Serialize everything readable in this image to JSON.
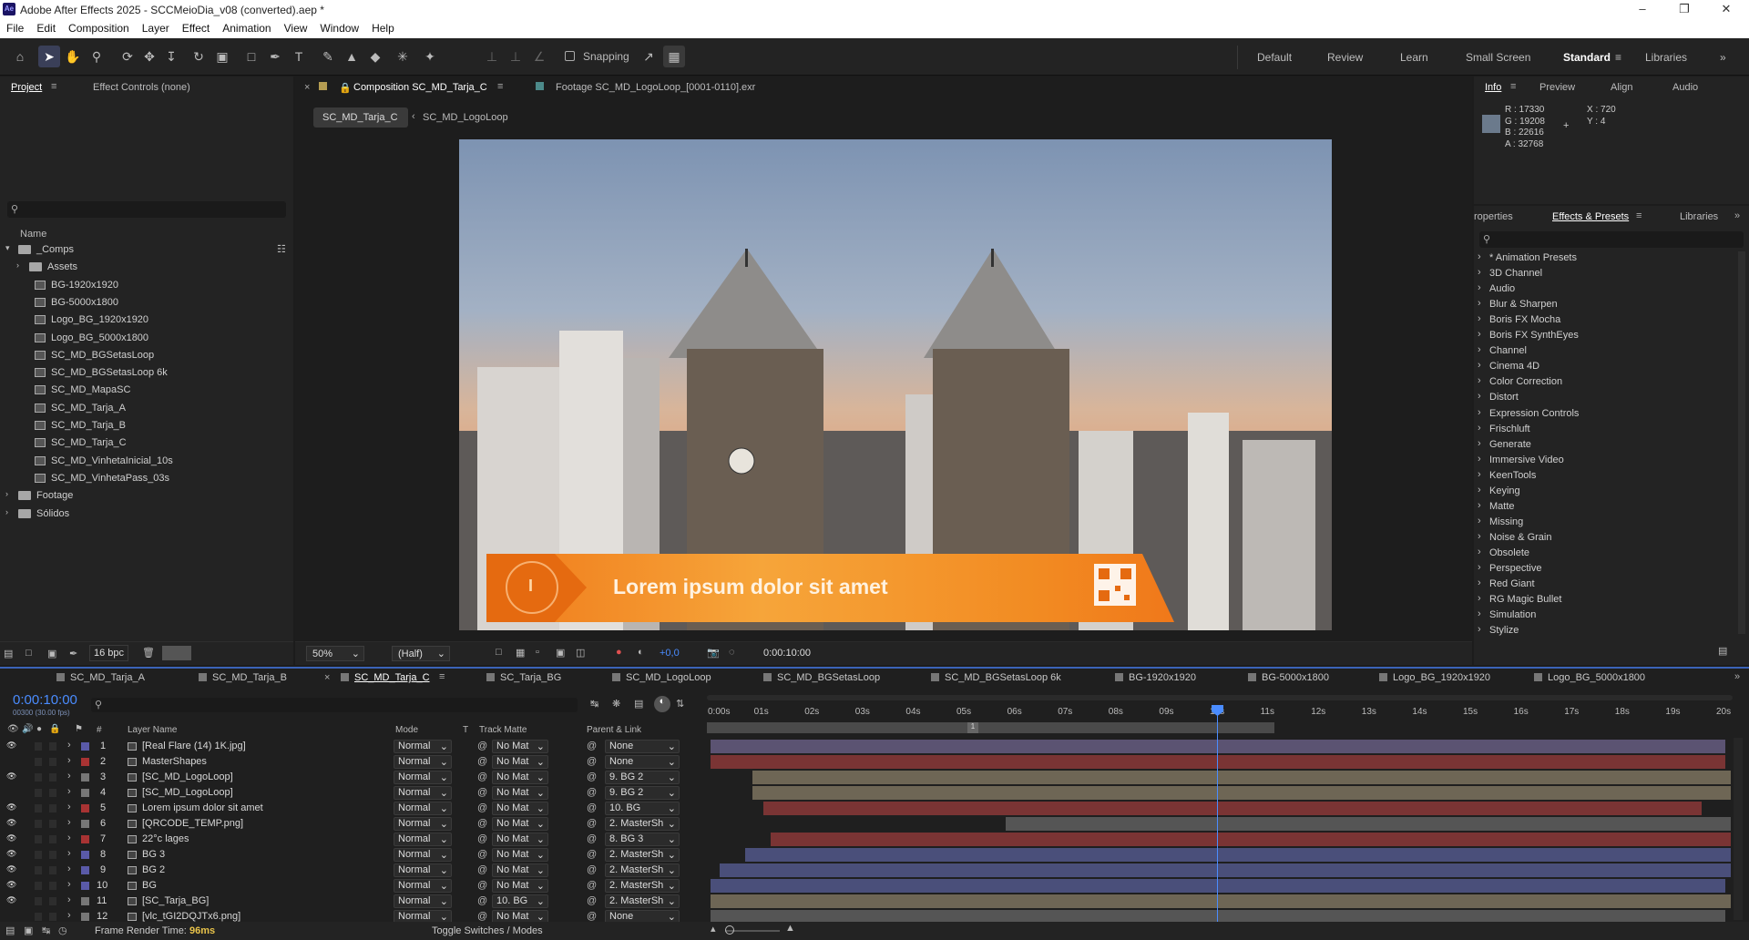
{
  "app": {
    "title": "Adobe After Effects 2025 - SCCMeioDia_v08 (converted).aep *",
    "logo": "Ae"
  },
  "menu": [
    "File",
    "Edit",
    "Composition",
    "Layer",
    "Effect",
    "Animation",
    "View",
    "Window",
    "Help"
  ],
  "toolbar": {
    "snapping_label": "Snapping"
  },
  "workspaces": [
    "Default",
    "Review",
    "Learn",
    "Small Screen",
    "Standard",
    "Libraries"
  ],
  "project": {
    "tabs": {
      "project": "Project",
      "effect_controls": "Effect Controls (none)"
    },
    "name_header": "Name",
    "items": [
      {
        "label": "_Comps",
        "type": "folder-open"
      },
      {
        "label": "Assets",
        "type": "folder"
      },
      {
        "label": "BG-1920x1920",
        "type": "comp"
      },
      {
        "label": "BG-5000x1800",
        "type": "comp"
      },
      {
        "label": "Logo_BG_1920x1920",
        "type": "comp"
      },
      {
        "label": "Logo_BG_5000x1800",
        "type": "comp"
      },
      {
        "label": "SC_MD_BGSetasLoop",
        "type": "comp"
      },
      {
        "label": "SC_MD_BGSetasLoop 6k",
        "type": "comp"
      },
      {
        "label": "SC_MD_MapaSC",
        "type": "comp"
      },
      {
        "label": "SC_MD_Tarja_A",
        "type": "comp"
      },
      {
        "label": "SC_MD_Tarja_B",
        "type": "comp"
      },
      {
        "label": "SC_MD_Tarja_C",
        "type": "comp"
      },
      {
        "label": "SC_MD_VinhetaInicial_10s",
        "type": "comp"
      },
      {
        "label": "SC_MD_VinhetaPass_03s",
        "type": "comp"
      },
      {
        "label": "Footage",
        "type": "folder"
      },
      {
        "label": "Sólidos",
        "type": "folder"
      }
    ],
    "bpc": "16 bpc"
  },
  "viewer": {
    "comp_tab": "Composition SC_MD_Tarja_C",
    "footage_tab": "Footage SC_MD_LogoLoop_[0001-0110].exr",
    "breadcrumbs": [
      "SC_MD_Tarja_C",
      "SC_MD_LogoLoop"
    ],
    "lower_third_text": "Lorem ipsum dolor sit amet",
    "badge_char": "I",
    "zoom": "50%",
    "resolution": "(Half)",
    "exposure": "+0,0",
    "timecode": "0:00:10:00"
  },
  "info": {
    "tabs": [
      "Info",
      "Preview",
      "Align",
      "Audio"
    ],
    "rgba": [
      "R : 17330",
      "G : 19208",
      "B : 22616",
      "A : 32768"
    ],
    "xy": [
      "X : 720",
      "Y : 4"
    ],
    "swatch": "#6b7a8c"
  },
  "effects": {
    "tabs": [
      "roperties",
      "Effects & Presets",
      "Libraries"
    ],
    "items": [
      "* Animation Presets",
      "3D Channel",
      "Audio",
      "Blur & Sharpen",
      "Boris FX Mocha",
      "Boris FX SynthEyes",
      "Channel",
      "Cinema 4D",
      "Color Correction",
      "Distort",
      "Expression Controls",
      "Frischluft",
      "Generate",
      "Immersive Video",
      "KeenTools",
      "Keying",
      "Matte",
      "Missing",
      "Noise & Grain",
      "Obsolete",
      "Perspective",
      "Red Giant",
      "RG Magic Bullet",
      "Simulation",
      "Stylize"
    ]
  },
  "timeline": {
    "tabs": [
      "SC_MD_Tarja_A",
      "SC_MD_Tarja_B",
      "SC_MD_Tarja_C",
      "SC_Tarja_BG",
      "SC_MD_LogoLoop",
      "SC_MD_BGSetasLoop",
      "SC_MD_BGSetasLoop 6k",
      "BG-1920x1920",
      "BG-5000x1800",
      "Logo_BG_1920x1920",
      "Logo_BG_5000x1800"
    ],
    "timecode": "0:00:10:00",
    "frames": "00300 (30.00 fps)",
    "headers": {
      "layer_name": "Layer Name",
      "mode": "Mode",
      "t": "T",
      "track_matte": "Track Matte",
      "parent": "Parent & Link",
      "num": "#"
    },
    "ruler": [
      "0:00s",
      "01s",
      "02s",
      "03s",
      "04s",
      "05s",
      "06s",
      "07s",
      "08s",
      "09s",
      "10s",
      "11s",
      "12s",
      "13s",
      "14s",
      "15s",
      "16s",
      "17s",
      "18s",
      "19s",
      "20s"
    ],
    "layers": [
      {
        "num": "1",
        "name": "[Real Flare (14) 1K.jpg]",
        "mode": "Normal",
        "matte": "No Mat",
        "parent": "None",
        "label": "#5a5aa8"
      },
      {
        "num": "2",
        "name": "MasterShapes",
        "mode": "Normal",
        "matte": "No Mat",
        "parent": "None",
        "label": "#a83333"
      },
      {
        "num": "3",
        "name": "[SC_MD_LogoLoop]",
        "mode": "Normal",
        "matte": "No Mat",
        "parent": "9. BG 2",
        "label": "#777777"
      },
      {
        "num": "4",
        "name": "[SC_MD_LogoLoop]",
        "mode": "Normal",
        "matte": "No Mat",
        "parent": "9. BG 2",
        "label": "#777777"
      },
      {
        "num": "5",
        "name": "Lorem ipsum dolor sit amet",
        "mode": "Normal",
        "matte": "No Mat",
        "parent": "10. BG",
        "label": "#a83333"
      },
      {
        "num": "6",
        "name": "[QRCODE_TEMP.png]",
        "mode": "Normal",
        "matte": "No Mat",
        "parent": "2. MasterSh",
        "label": "#777777"
      },
      {
        "num": "7",
        "name": "22°c lages",
        "mode": "Normal",
        "matte": "No Mat",
        "parent": "8. BG 3",
        "label": "#a83333"
      },
      {
        "num": "8",
        "name": "BG 3",
        "mode": "Normal",
        "matte": "No Mat",
        "parent": "2. MasterSh",
        "label": "#5a5aa8"
      },
      {
        "num": "9",
        "name": "BG 2",
        "mode": "Normal",
        "matte": "No Mat",
        "parent": "2. MasterSh",
        "label": "#5a5aa8"
      },
      {
        "num": "10",
        "name": "BG",
        "mode": "Normal",
        "matte": "No Mat",
        "parent": "2. MasterSh",
        "label": "#5a5aa8"
      },
      {
        "num": "11",
        "name": "[SC_Tarja_BG]",
        "mode": "Normal",
        "matte": "10. BG",
        "parent": "2. MasterSh",
        "label": "#777777"
      },
      {
        "num": "12",
        "name": "[vlc_tGI2DQJTx6.png]",
        "mode": "Normal",
        "matte": "No Mat",
        "parent": "None",
        "label": "#777777"
      }
    ],
    "status": {
      "render_time": "Frame Render Time: ",
      "render_value": "96ms",
      "toggle": "Toggle Switches / Modes"
    },
    "marker": "1"
  }
}
